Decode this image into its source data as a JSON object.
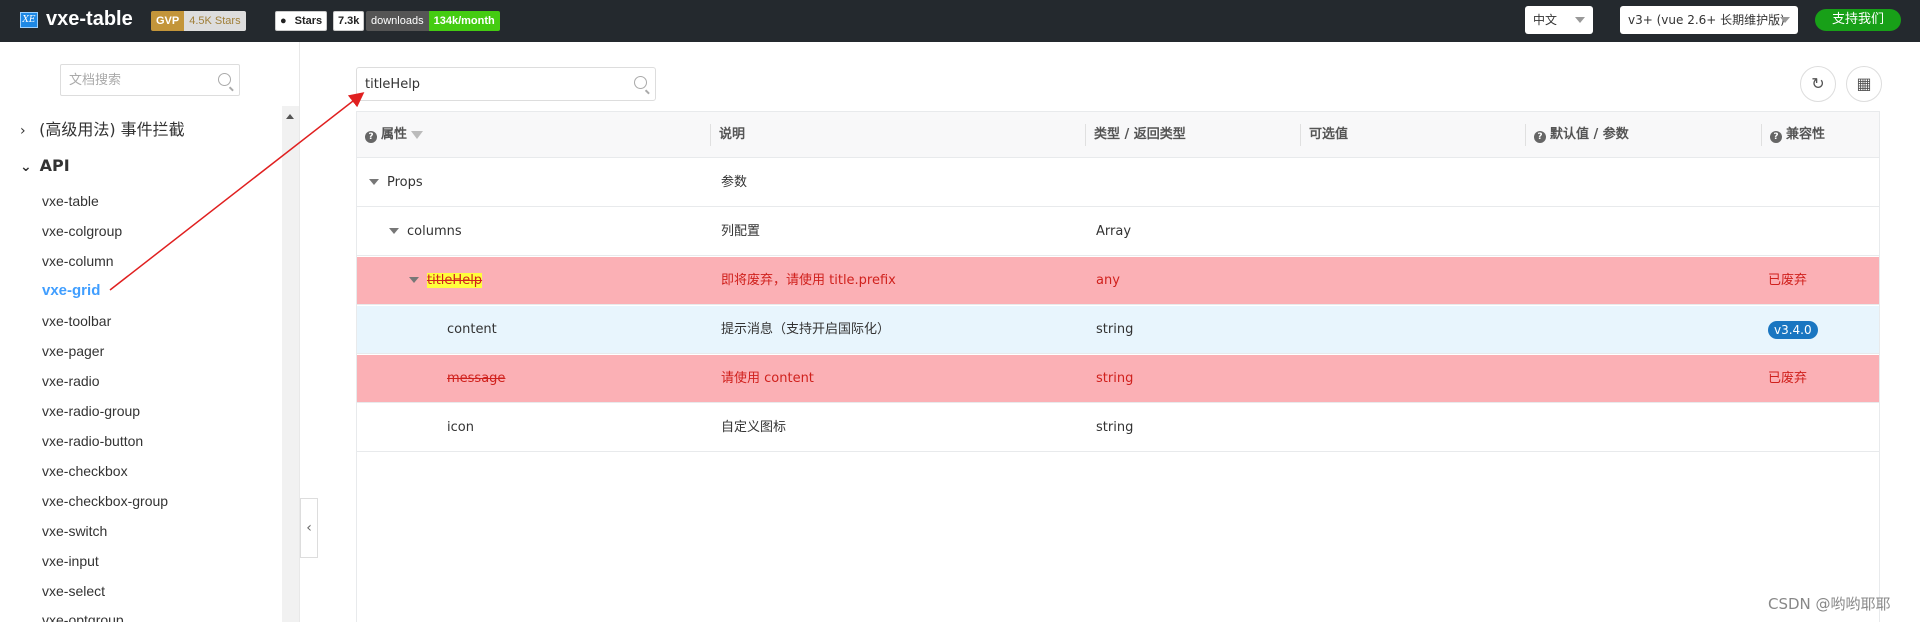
{
  "header": {
    "logo_text": "XE",
    "brand": "vxe-table",
    "gvp_label": "GVP",
    "gvp_stars": "4.5K Stars",
    "github_label": "Stars",
    "github_count": "7.3k",
    "downloads_label": "downloads",
    "downloads_value": "134k/month",
    "language": "中文",
    "version": "v3+ (vue 2.6+ 长期维护版)",
    "support_label": "支持我们"
  },
  "sidebar": {
    "search_placeholder": "文档搜索",
    "groups": [
      {
        "label": "(高级用法) 事件拦截",
        "expanded": false
      },
      {
        "label": "API",
        "expanded": true
      }
    ],
    "items": [
      {
        "label": "vxe-table",
        "active": false
      },
      {
        "label": "vxe-colgroup",
        "active": false
      },
      {
        "label": "vxe-column",
        "active": false
      },
      {
        "label": "vxe-grid",
        "active": true
      },
      {
        "label": "vxe-toolbar",
        "active": false
      },
      {
        "label": "vxe-pager",
        "active": false
      },
      {
        "label": "vxe-radio",
        "active": false
      },
      {
        "label": "vxe-radio-group",
        "active": false
      },
      {
        "label": "vxe-radio-button",
        "active": false
      },
      {
        "label": "vxe-checkbox",
        "active": false
      },
      {
        "label": "vxe-checkbox-group",
        "active": false
      },
      {
        "label": "vxe-switch",
        "active": false
      },
      {
        "label": "vxe-input",
        "active": false
      },
      {
        "label": "vxe-select",
        "active": false
      },
      {
        "label": "vxe-optgroup",
        "active": false
      }
    ]
  },
  "main": {
    "search_value": "titleHelp",
    "columns": [
      "属性",
      "说明",
      "类型 / 返回类型",
      "可选值",
      "默认值 / 参数",
      "兼容性"
    ],
    "rows": [
      {
        "name": "Props",
        "desc": "参数",
        "type": "",
        "options": "",
        "default": "",
        "compat": "",
        "level": 0,
        "tree": true,
        "style": ""
      },
      {
        "name": "columns",
        "desc": "列配置",
        "type": "Array",
        "options": "",
        "default": "",
        "compat": "",
        "level": 1,
        "tree": true,
        "style": ""
      },
      {
        "name": "titleHelp",
        "desc": "即将废弃，请使用 title.prefix",
        "type": "any",
        "options": "",
        "default": "",
        "compat": "已废弃",
        "level": 2,
        "tree": true,
        "style": "deprecated"
      },
      {
        "name": "content",
        "desc": "提示消息（支持开启国际化）",
        "type": "string",
        "options": "",
        "default": "",
        "compat": "v3.4.0",
        "level": 3,
        "tree": false,
        "style": "new"
      },
      {
        "name": "message",
        "desc": "请使用 content",
        "type": "string",
        "options": "",
        "default": "",
        "compat": "已废弃",
        "level": 3,
        "tree": false,
        "style": "deprecated"
      },
      {
        "name": "icon",
        "desc": "自定义图标",
        "type": "string",
        "options": "",
        "default": "",
        "compat": "",
        "level": 3,
        "tree": false,
        "style": ""
      }
    ]
  },
  "watermark": "CSDN @哟哟耶耶",
  "colors": {
    "header_bg": "#24292e",
    "active_link": "#409eff",
    "deprecated_row": "#fbb0b5",
    "deprecated_text": "#d0211d",
    "new_row": "#e8f5fd",
    "version_badge": "#1a76c1",
    "support_button": "#18a018",
    "annotation_arrow": "#e02020"
  }
}
